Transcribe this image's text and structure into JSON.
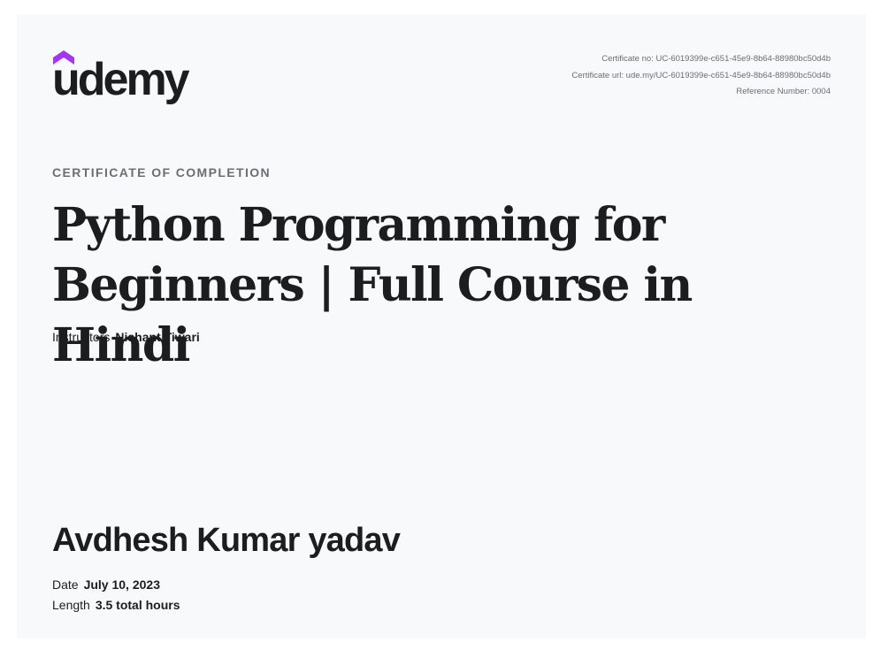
{
  "brand": {
    "logo_text": "udemy",
    "accent_color": "#a435f0"
  },
  "meta": {
    "certificate_no": "Certificate no: UC-6019399e-c651-45e9-8b64-88980bc50d4b",
    "certificate_url": "Certificate url: ude.my/UC-6019399e-c651-45e9-8b64-88980bc50d4b",
    "reference_number": "Reference Number: 0004"
  },
  "kicker": "CERTIFICATE OF COMPLETION",
  "course": {
    "title_line1": "Python Programming for",
    "title_line2": "Beginners | Full Course in Hindi"
  },
  "instructors": {
    "label": "Instructors",
    "value": "Nishant Tiwari"
  },
  "recipient": {
    "name": "Avdhesh Kumar yadav"
  },
  "details": {
    "date_label": "Date",
    "date_value": "July 10, 2023",
    "length_label": "Length",
    "length_value": "3.5 total hours"
  }
}
